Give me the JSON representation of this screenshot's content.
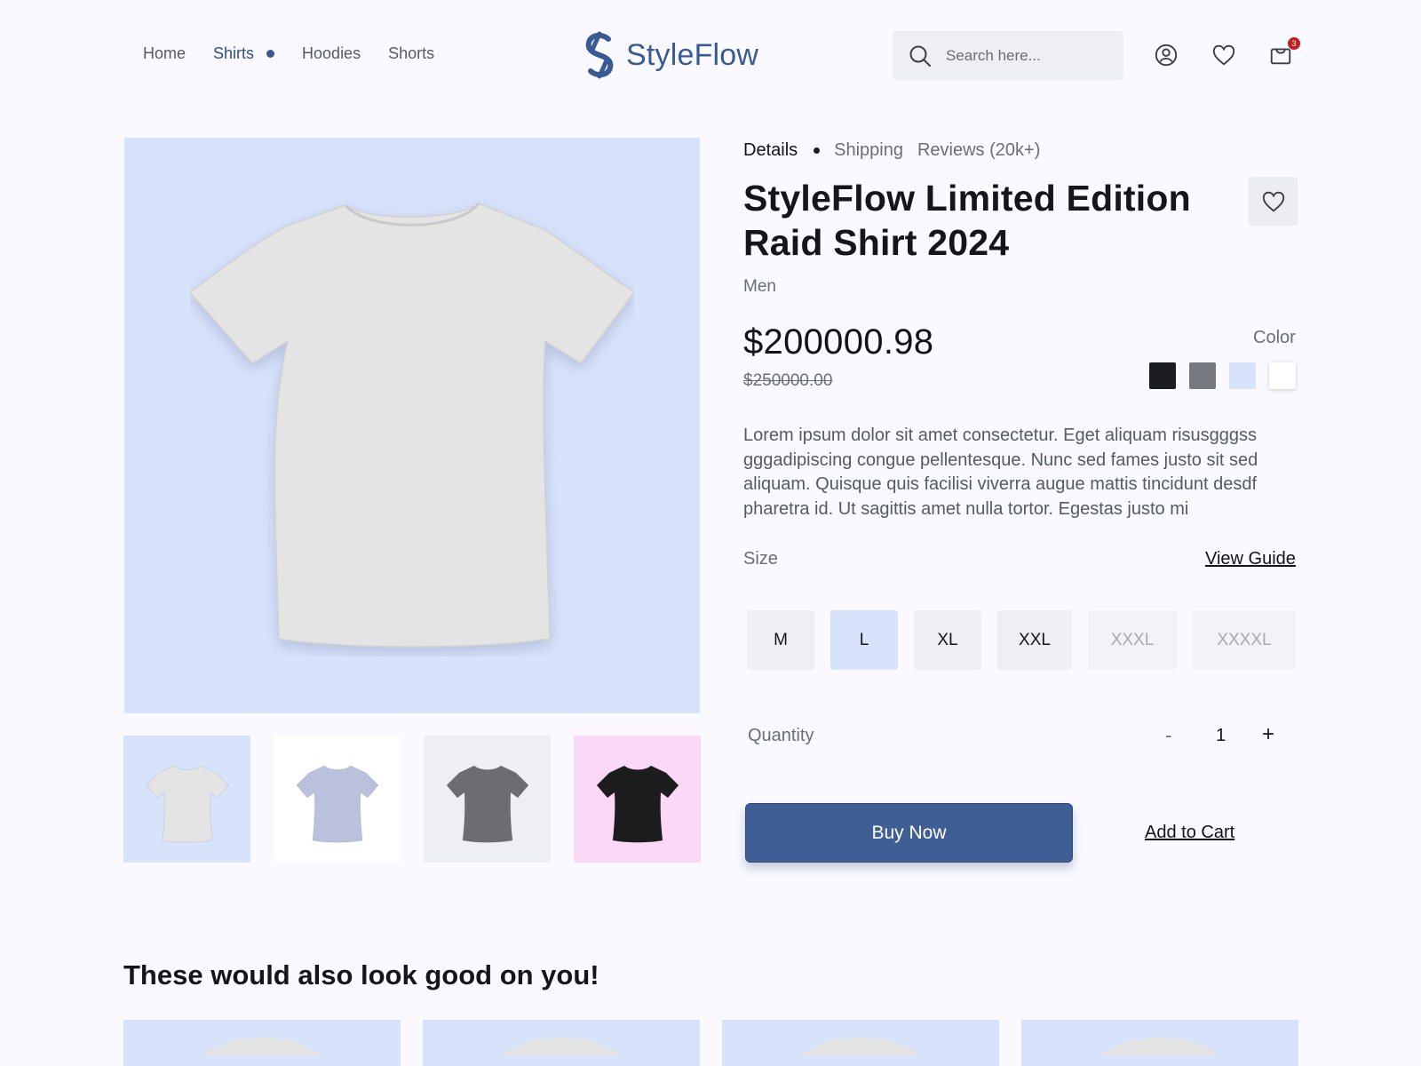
{
  "header": {
    "nav": [
      {
        "label": "Home"
      },
      {
        "label": "Shirts",
        "active": true
      },
      {
        "label": "Hoodies"
      },
      {
        "label": "Shorts"
      }
    ],
    "brand": "StyleFlow",
    "search": {
      "placeholder": "Search here...",
      "value": ""
    },
    "icons": [
      "user-icon",
      "heart-icon",
      "cart-icon"
    ],
    "cart_count": "3"
  },
  "product": {
    "tabs": [
      {
        "label": "Details",
        "active": true
      },
      {
        "label": "Shipping"
      },
      {
        "label": "Reviews (20k+)"
      }
    ],
    "title": "StyleFlow Limited Edition Raid Shirt 2024",
    "category": "Men",
    "price": "$200000.98",
    "old_price": "$250000.00",
    "color_label": "Color",
    "colors": [
      "#1b1d23",
      "#767980",
      "#d7e2fb",
      "#ffffff"
    ],
    "description": "Lorem ipsum dolor sit amet consectetur. Eget aliquam risusgggss gggadipiscing congue pellentesque. Nunc sed fames justo sit sed aliquam. Quisque quis facilisi viverra augue mattis tincidunt desdf pharetra id. Ut sagittis amet nulla tortor. Egestas justo mi",
    "size_label": "Size",
    "view_guide": "View Guide",
    "sizes": [
      {
        "label": "M",
        "state": "available"
      },
      {
        "label": "L",
        "state": "selected"
      },
      {
        "label": "XL",
        "state": "available"
      },
      {
        "label": "XXL",
        "state": "available"
      },
      {
        "label": "XXXL",
        "state": "disabled"
      },
      {
        "label": "XXXXL",
        "state": "disabled"
      }
    ],
    "quantity_label": "Quantity",
    "quantity_minus": "-",
    "quantity": "1",
    "quantity_plus": "+",
    "buy_label": "Buy Now",
    "add_cart_label": "Add to Cart",
    "thumbnails": [
      {
        "bg": "#d7e2fb",
        "shirt": "#e4e4e4"
      },
      {
        "bg": "#ffffff",
        "shirt": "#b9c1dc"
      },
      {
        "bg": "#eeeff2",
        "shirt": "#6b6d70"
      },
      {
        "bg": "#fbd8f5",
        "shirt": "#1c1c1e"
      }
    ],
    "main_image_bg": "#d7e2fb",
    "main_shirt_color": "#e4e4e4"
  },
  "recommendations": {
    "title": "These would also look good on you!",
    "count": 4
  },
  "colors": {
    "accent": "#3f5e94",
    "background": "#f9f9ff"
  }
}
